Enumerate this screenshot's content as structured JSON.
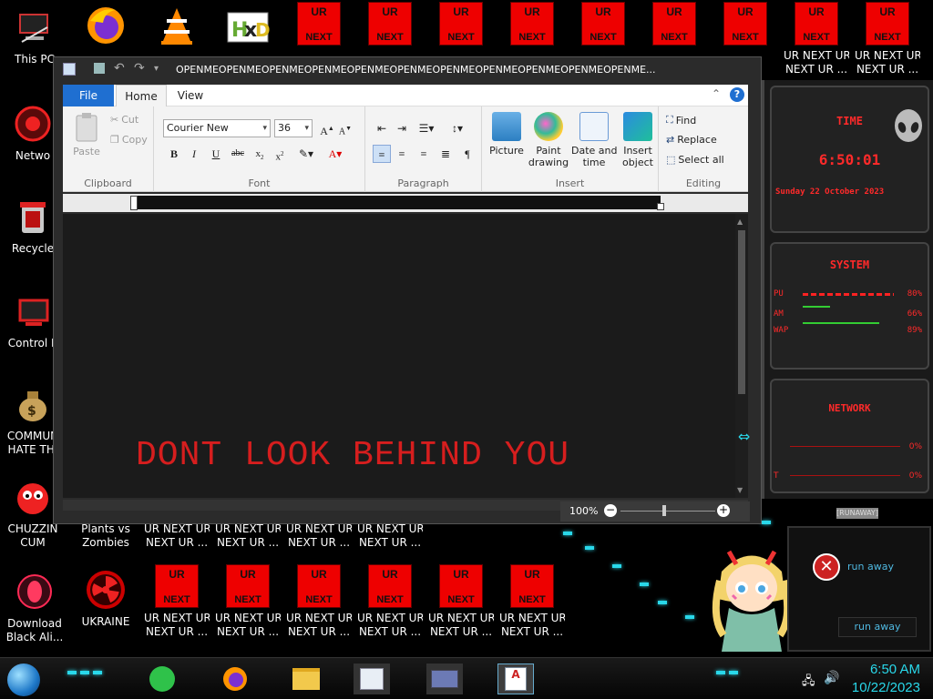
{
  "desktop_icons": {
    "row1": [
      {
        "id": "this-pc",
        "label": "This PC",
        "icon": "pc-icon"
      },
      {
        "id": "firefox",
        "label": "",
        "icon": "firefox-icon"
      },
      {
        "id": "vlc",
        "label": "",
        "icon": "vlc-icon"
      },
      {
        "id": "hxd",
        "label": "",
        "icon": "hxd-icon"
      },
      {
        "id": "ur1",
        "top": "UR",
        "bottom": "NEXT",
        "label": ""
      },
      {
        "id": "ur2",
        "top": "UR",
        "bottom": "NEXT",
        "label": ""
      },
      {
        "id": "ur3",
        "top": "UR",
        "bottom": "NEXT",
        "label": ""
      },
      {
        "id": "ur4",
        "top": "UR",
        "bottom": "NEXT",
        "label": ""
      },
      {
        "id": "ur5",
        "top": "UR",
        "bottom": "NEXT",
        "label": ""
      },
      {
        "id": "ur6",
        "top": "UR",
        "bottom": "NEXT",
        "label": ""
      },
      {
        "id": "ur7",
        "top": "UR",
        "bottom": "NEXT",
        "label": ""
      },
      {
        "id": "ur8",
        "top": "UR",
        "bottom": "NEXT",
        "label": "UR NEXT UR\nNEXT UR ..."
      },
      {
        "id": "ur9",
        "top": "UR",
        "bottom": "NEXT",
        "label": "UR NEXT UR\nNEXT UR ..."
      }
    ],
    "left_column": [
      {
        "id": "network",
        "label": "Netwo"
      },
      {
        "id": "recycle",
        "label": "Recycle"
      },
      {
        "id": "control",
        "label": "Control P"
      },
      {
        "id": "commun",
        "label": "COMMUN\nHATE THI"
      },
      {
        "id": "chuzzin",
        "label": "CHUZZIN\nCUM"
      },
      {
        "id": "download",
        "label": "Download\nBlack Ali..."
      }
    ],
    "row_behind_labels": [
      "Plants vs\nZombies",
      "UR NEXT UR\nNEXT UR ...",
      "UR NEXT UR\nNEXT UR ...",
      "UR NEXT UR\nNEXT UR ...",
      "UR NEXT UR\nNEXT UR ..."
    ],
    "row_bottom": [
      {
        "id": "ukraine",
        "label": "UKRAINE"
      },
      {
        "id": "urb1",
        "top": "UR",
        "bottom": "NEXT",
        "label": "UR NEXT UR\nNEXT UR ..."
      },
      {
        "id": "urb2",
        "top": "UR",
        "bottom": "NEXT",
        "label": "UR NEXT UR\nNEXT UR ..."
      },
      {
        "id": "urb3",
        "top": "UR",
        "bottom": "NEXT",
        "label": "UR NEXT UR\nNEXT UR ..."
      },
      {
        "id": "urb4",
        "top": "UR",
        "bottom": "NEXT",
        "label": "UR NEXT UR\nNEXT UR ..."
      },
      {
        "id": "urb5",
        "top": "UR",
        "bottom": "NEXT",
        "label": "UR NEXT UR\nNEXT UR ..."
      },
      {
        "id": "urb6",
        "top": "UR",
        "bottom": "NEXT",
        "label": "UR NEXT UR\nNEXT UR ..."
      }
    ]
  },
  "wordpad": {
    "title": "OPENMEOPENMEOPENMEOPENMEOPENMEOPENMEOPENMEOPENMEOPENMEOPENMEOPENME...",
    "tabs": {
      "file": "File",
      "home": "Home",
      "view": "View"
    },
    "clipboard": {
      "group": "Clipboard",
      "paste": "Paste",
      "cut": "Cut",
      "copy": "Copy"
    },
    "font": {
      "group": "Font",
      "family": "Courier New",
      "size": "36"
    },
    "paragraph": {
      "group": "Paragraph"
    },
    "insert": {
      "group": "Insert",
      "picture": "Picture",
      "paint": "Paint\ndrawing",
      "datetime": "Date and\ntime",
      "object": "Insert\nobject"
    },
    "editing": {
      "group": "Editing",
      "find": "Find",
      "replace": "Replace",
      "select_all": "Select all"
    },
    "document_text": "DONT LOOK BEHIND YOU",
    "zoom": "100%"
  },
  "widget": {
    "time_title": "TIME",
    "time": "6:50:01",
    "date": "Sunday 22 October 2023",
    "system_title": "SYSTEM",
    "cpu_label": "PU",
    "cpu_pct": "80%",
    "ram_label": "AM",
    "ram_pct": "66%",
    "swap_label": "WAP",
    "swap_pct": "89%",
    "network_title": "NETWORK",
    "net_up": "0%",
    "net_down": "0%",
    "net_up_label": "",
    "net_down_label": "T",
    "stop_tag": "[RUNAWAY]"
  },
  "runaway": {
    "message": "run away",
    "button": "run away"
  },
  "taskbar": {
    "time": "6:50 AM",
    "date": "10/22/2023"
  },
  "colors": {
    "accent_red": "#e00000",
    "doc_text": "#d61e1e",
    "cyan": "#29d8ea"
  }
}
